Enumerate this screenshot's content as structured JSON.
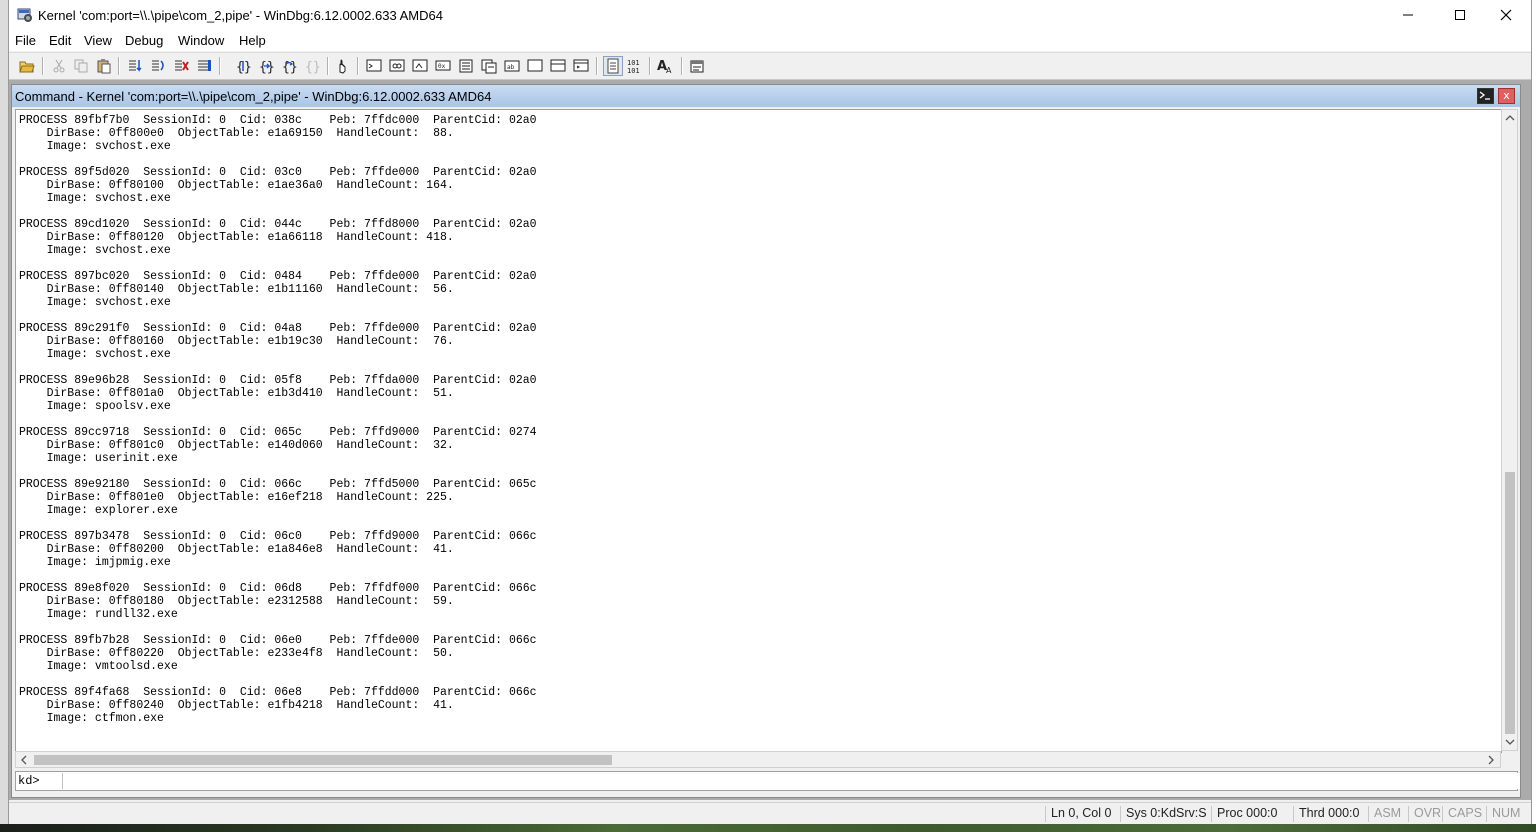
{
  "window": {
    "title": "Kernel 'com:port=\\\\.\\pipe\\com_2,pipe' - WinDbg:6.12.0002.633 AMD64"
  },
  "menu": [
    "File",
    "Edit",
    "View",
    "Debug",
    "Window",
    "Help"
  ],
  "toolbar": {
    "icons": [
      "open-icon",
      "cut-icon",
      "copy-icon",
      "paste-icon",
      "step-into-icon",
      "step-over-icon",
      "step-out-icon",
      "run-to-cursor-icon",
      "restart-icon",
      "stop-icon",
      "break-icon",
      "hand-icon",
      "command-icon",
      "watch-icon",
      "locals-icon",
      "registers-icon",
      "memory-icon",
      "call-stack-icon",
      "disassembly-icon",
      "scratch-pad-icon",
      "processes-icon",
      "source-mode-icon",
      "hex-mode-icon",
      "font-icon",
      "options-icon"
    ]
  },
  "command_window": {
    "title": "Command - Kernel 'com:port=\\\\.\\pipe\\com_2,pipe' - WinDbg:6.12.0002.633 AMD64",
    "close_label": "x",
    "output_lines": [
      "PROCESS 89fbf7b0  SessionId: 0  Cid: 038c    Peb: 7ffdc000  ParentCid: 02a0",
      "    DirBase: 0ff800e0  ObjectTable: e1a69150  HandleCount:  88.",
      "    Image: svchost.exe",
      "",
      "PROCESS 89f5d020  SessionId: 0  Cid: 03c0    Peb: 7ffde000  ParentCid: 02a0",
      "    DirBase: 0ff80100  ObjectTable: e1ae36a0  HandleCount: 164.",
      "    Image: svchost.exe",
      "",
      "PROCESS 89cd1020  SessionId: 0  Cid: 044c    Peb: 7ffd8000  ParentCid: 02a0",
      "    DirBase: 0ff80120  ObjectTable: e1a66118  HandleCount: 418.",
      "    Image: svchost.exe",
      "",
      "PROCESS 897bc020  SessionId: 0  Cid: 0484    Peb: 7ffde000  ParentCid: 02a0",
      "    DirBase: 0ff80140  ObjectTable: e1b11160  HandleCount:  56.",
      "    Image: svchost.exe",
      "",
      "PROCESS 89c291f0  SessionId: 0  Cid: 04a8    Peb: 7ffde000  ParentCid: 02a0",
      "    DirBase: 0ff80160  ObjectTable: e1b19c30  HandleCount:  76.",
      "    Image: svchost.exe",
      "",
      "PROCESS 89e96b28  SessionId: 0  Cid: 05f8    Peb: 7ffda000  ParentCid: 02a0",
      "    DirBase: 0ff801a0  ObjectTable: e1b3d410  HandleCount:  51.",
      "    Image: spoolsv.exe",
      "",
      "PROCESS 89cc9718  SessionId: 0  Cid: 065c    Peb: 7ffd9000  ParentCid: 0274",
      "    DirBase: 0ff801c0  ObjectTable: e140d060  HandleCount:  32.",
      "    Image: userinit.exe",
      "",
      "PROCESS 89e92180  SessionId: 0  Cid: 066c    Peb: 7ffd5000  ParentCid: 065c",
      "    DirBase: 0ff801e0  ObjectTable: e16ef218  HandleCount: 225.",
      "    Image: explorer.exe",
      "",
      "PROCESS 897b3478  SessionId: 0  Cid: 06c0    Peb: 7ffd9000  ParentCid: 066c",
      "    DirBase: 0ff80200  ObjectTable: e1a846e8  HandleCount:  41.",
      "    Image: imjpmig.exe",
      "",
      "PROCESS 89e8f020  SessionId: 0  Cid: 06d8    Peb: 7ffdf000  ParentCid: 066c",
      "    DirBase: 0ff80180  ObjectTable: e2312588  HandleCount:  59.",
      "    Image: rundll32.exe",
      "",
      "PROCESS 89fb7b28  SessionId: 0  Cid: 06e0    Peb: 7ffde000  ParentCid: 066c",
      "    DirBase: 0ff80220  ObjectTable: e233e4f8  HandleCount:  50.",
      "    Image: vmtoolsd.exe",
      "",
      "PROCESS 89f4fa68  SessionId: 0  Cid: 06e8    Peb: 7ffdd000  ParentCid: 066c",
      "    DirBase: 0ff80240  ObjectTable: e1fb4218  HandleCount:  41.",
      "    Image: ctfmon.exe"
    ],
    "prompt": "kd>",
    "input_value": ""
  },
  "statusbar": {
    "position": "Ln 0, Col 0",
    "sys": "Sys 0:KdSrv:S",
    "proc": "Proc 000:0",
    "thrd": "Thrd 000:0",
    "asm": "ASM",
    "ovr": "OVR",
    "caps": "CAPS",
    "num": "NUM"
  }
}
